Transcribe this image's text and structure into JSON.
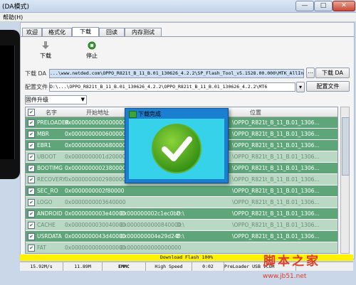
{
  "window": {
    "title": "(DA模式)",
    "close_glyph": "✕",
    "min_glyph": "—",
    "max_glyph": "□"
  },
  "menu": {
    "help": "帮助(H)"
  },
  "tabs": [
    "欢迎",
    "格式化",
    "下载",
    "回读",
    "内存测试"
  ],
  "active_tab": 2,
  "toolbar": {
    "download_label": "下载",
    "stop_label": "停止"
  },
  "download_agent": {
    "label": "下载 DA",
    "path": "...\\www.netded.com\\OPPO_R821t_B_11_B.01_130626_4.2.2\\SP_Flash_Tool_v5.1528.00.000\\MTK_AllInOne_DA.bin",
    "button": "下载 DA"
  },
  "scatter": {
    "label": "配置文件",
    "path": "D:\\...\\OPPO_R821t_B_11_B.01_130626_4.2.2\\OPPO_R821t_B_11_B.01_130626_4.2.2\\MT6",
    "button": "配置文件"
  },
  "mode_select": {
    "value": "固件升级"
  },
  "table": {
    "headers": [
      "名字",
      "开始地址",
      "位置"
    ],
    "rows": [
      {
        "name": "PRELOADER",
        "addr": "0x0000000000000000",
        "loc": "\\OPPO_R821t_B_11_B.01_1306...",
        "style": "g"
      },
      {
        "name": "MBR",
        "addr": "0x0000000000600000",
        "loc": "\\OPPO_R821t_B_11_B.01_1306...",
        "style": "g"
      },
      {
        "name": "EBR1",
        "addr": "0x0000000000680000",
        "loc": "\\OPPO_R821t_B_11_B.01_1306...",
        "style": "g"
      },
      {
        "name": "UBOOT",
        "addr": "0x0000000001d20000",
        "loc": "\\OPPO_R821t_B_11_B.01_1306...",
        "style": "w"
      },
      {
        "name": "BOOTIMG",
        "addr": "0x0000000002380000",
        "loc": "\\OPPO_R821t_B_11_B.01_1306...",
        "style": "g"
      },
      {
        "name": "RECOVERY",
        "addr": "0x0000000002980000",
        "loc": "\\OPPO_R821t_B_11_B.01_1306...",
        "style": "w"
      },
      {
        "name": "SEC_RO",
        "addr": "0x0000000002f80000",
        "loc": "\\OPPO_R821t_B_11_B.01_1306...",
        "style": "g"
      },
      {
        "name": "LOGO",
        "addr": "0x0000000003640000",
        "loc": "\\OPPO_R821t_B_11_B.01_1306...",
        "style": "w"
      },
      {
        "name": "ANDROID",
        "addr": "0x0000000003e40000",
        "size": "0x000000002c1ec0bb",
        "drive": "D:\\",
        "loc": "\\OPPO_R821t_B_11_B.01_1306...",
        "style": "g"
      },
      {
        "name": "CACHE",
        "addr": "0x0000000030040000",
        "size": "0x0000000000840000",
        "drive": "D:\\",
        "loc": "\\OPPO_R821t_B_11_B.01_1306...",
        "style": "w"
      },
      {
        "name": "USRDATA",
        "addr": "0x0000000043d40000",
        "size": "0x000000004e29d24f",
        "drive": "D:\\",
        "loc": "\\OPPO_R821t_B_11_B.01_1306...",
        "style": "g"
      },
      {
        "name": "FAT",
        "addr": "0x0000000000000000",
        "size": "0x0000000000000000",
        "drive": "",
        "loc": "",
        "style": "w"
      }
    ]
  },
  "dialog": {
    "title": "下载完成",
    "result": "success",
    "check_color": "#3c9a1e"
  },
  "status": {
    "progress_text": "Download Flash 100%",
    "progress_fraction": 1.0,
    "speed": "15.92M/s",
    "size": "11.89M",
    "storage": "EMMC",
    "usb_speed": "High Speed",
    "time": "0:02",
    "port": "PreLoader USB VCOM"
  },
  "watermark": {
    "text": "脚本之家",
    "url": "www.jb51.net",
    "color": "#e03a2a"
  }
}
